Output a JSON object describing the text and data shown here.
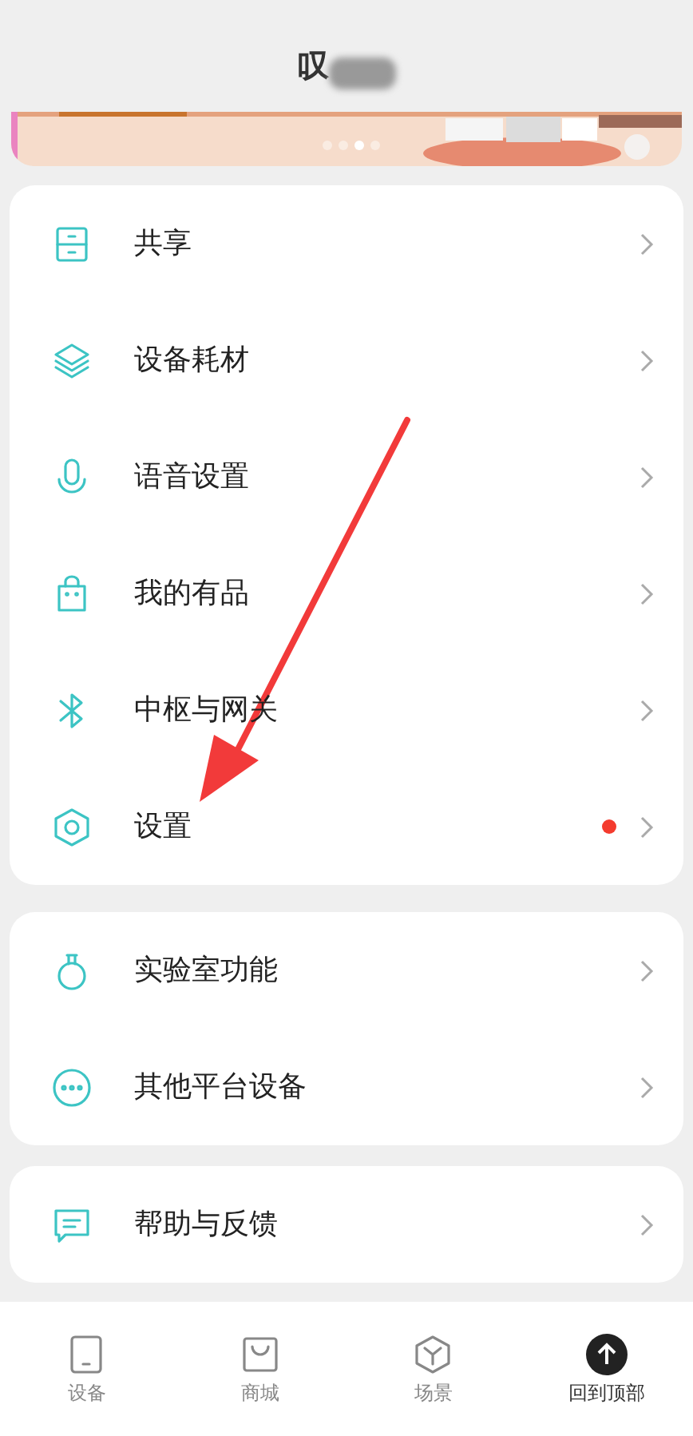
{
  "header": {
    "title": "叹",
    "title_obscured": true
  },
  "banner": {
    "dots": [
      {
        "selected": false
      },
      {
        "selected": false
      },
      {
        "selected": true
      },
      {
        "selected": false
      }
    ]
  },
  "groups": [
    {
      "items": [
        {
          "label": "共享",
          "badge": false
        },
        {
          "label": "设备耗材",
          "badge": false
        },
        {
          "label": "语音设置",
          "badge": false
        },
        {
          "label": "我的有品",
          "badge": false
        },
        {
          "label": "中枢与网关",
          "badge": false
        },
        {
          "label": "设置",
          "badge": true
        }
      ]
    },
    {
      "items": [
        {
          "label": "实验室功能",
          "badge": false
        },
        {
          "label": "其他平台设备",
          "badge": false
        }
      ]
    },
    {
      "items": [
        {
          "label": "帮助与反馈",
          "badge": false
        }
      ]
    }
  ],
  "tab_bar": [
    {
      "label": "设备",
      "selected": false
    },
    {
      "label": "商城",
      "selected": false
    },
    {
      "label": "场景",
      "selected": false
    },
    {
      "kind": "action",
      "label": "回到顶部",
      "selected": false
    }
  ],
  "annotation": {
    "kind": "arrow"
  }
}
